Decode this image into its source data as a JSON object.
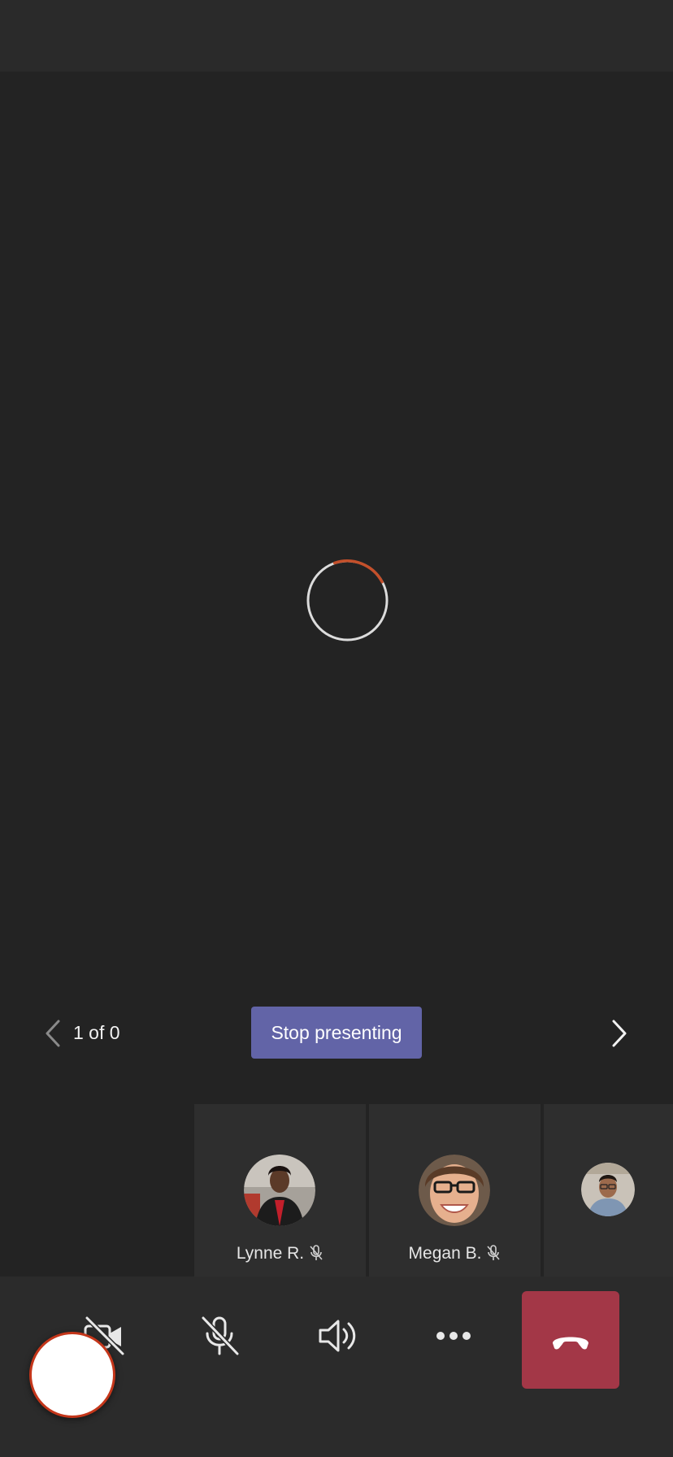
{
  "pager": {
    "counter": "1 of 0",
    "stop_presenting_label": "Stop presenting"
  },
  "participants": [
    {
      "name": "Lynne R.",
      "muted": true
    },
    {
      "name": "Megan B.",
      "muted": true
    },
    {
      "name": "",
      "muted": false
    }
  ],
  "controls": {
    "camera": "video-off-icon",
    "mic": "mic-off-icon",
    "speaker": "speaker-icon",
    "more": "more-icon",
    "end": "hang-up-icon"
  },
  "colors": {
    "accent": "#6264a7",
    "end_call": "#a33747",
    "spinner_arc": "#c4502b",
    "self_view_ring": "#c4361a"
  }
}
